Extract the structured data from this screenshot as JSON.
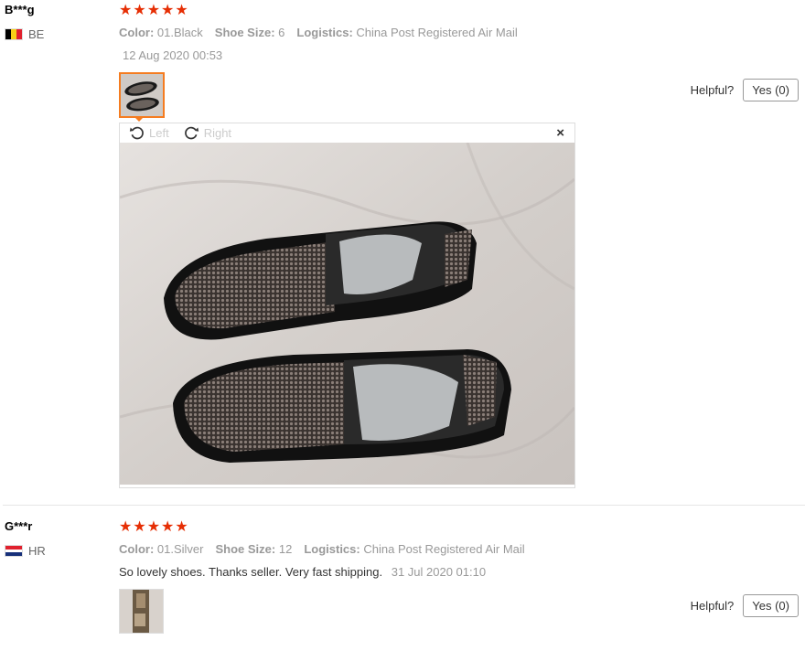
{
  "reviews": [
    {
      "user": "B***g",
      "country": "BE",
      "rating": 5,
      "meta": [
        {
          "key": "Color:",
          "value": "01.Black"
        },
        {
          "key": "Shoe Size:",
          "value": "6"
        },
        {
          "key": "Logistics:",
          "value": "China Post Registered Air Mail"
        }
      ],
      "date": "12 Aug 2020 00:53",
      "helpful_label": "Helpful?",
      "yes_label": "Yes (0)",
      "viewer": {
        "rotate_left": "Left",
        "rotate_right": "Right",
        "close": "×"
      }
    },
    {
      "user": "G***r",
      "country": "HR",
      "rating": 5,
      "meta": [
        {
          "key": "Color:",
          "value": "01.Silver"
        },
        {
          "key": "Shoe Size:",
          "value": "12"
        },
        {
          "key": "Logistics:",
          "value": "China Post Registered Air Mail"
        }
      ],
      "text": "So lovely shoes. Thanks seller. Very fast shipping.",
      "date": "31 Jul 2020 01:10",
      "helpful_label": "Helpful?",
      "yes_label": "Yes (0)"
    }
  ],
  "colors": {
    "star": "#e62e04",
    "accent": "#f57c20",
    "muted": "#999999"
  },
  "icons": [
    "star-icon",
    "rotate-left-icon",
    "rotate-right-icon",
    "close-icon",
    "flag-be-icon",
    "flag-hr-icon"
  ]
}
